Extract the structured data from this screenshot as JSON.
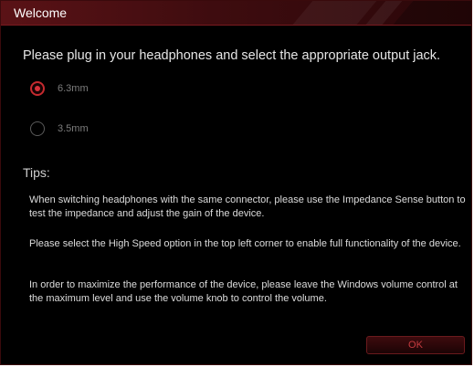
{
  "window": {
    "title": "Welcome"
  },
  "instruction": "Please plug in your headphones and select the appropriate output jack.",
  "output_jack": {
    "options": [
      {
        "label": "6.3mm",
        "selected": true
      },
      {
        "label": "3.5mm",
        "selected": false
      }
    ]
  },
  "tips": {
    "heading": "Tips:",
    "items": [
      "When switching headphones with the same connector, please use the Impedance Sense button  to test the impedance and adjust the gain of the device.",
      "Please select the High Speed option in the top left corner to enable full functionality of the device.",
      "In order to maximize the performance of the device, please leave the Windows volume control at the maximum level and use the volume knob to control the volume."
    ]
  },
  "buttons": {
    "ok_label": "OK"
  },
  "colors": {
    "accent": "#d6313a",
    "background": "#000000",
    "titlebar": "#5a1216"
  }
}
